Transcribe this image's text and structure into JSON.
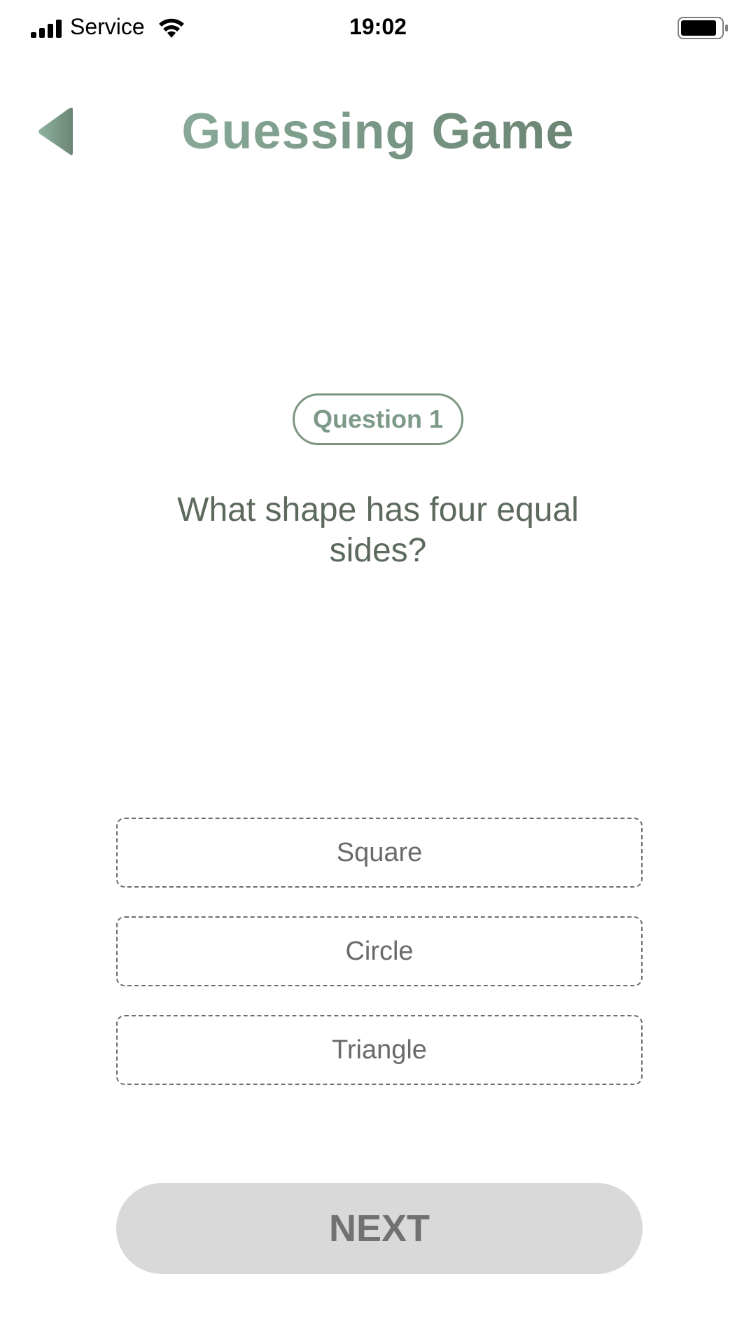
{
  "status_bar": {
    "carrier": "Service",
    "time": "19:02",
    "icons": [
      "signal-icon",
      "wifi-icon",
      "battery-icon"
    ]
  },
  "header": {
    "back_icon": "back-arrow-icon",
    "title": "Guessing Game"
  },
  "question": {
    "label": "Question 1",
    "text": "What shape has four equal sides?"
  },
  "options": [
    {
      "label": "Square"
    },
    {
      "label": "Circle"
    },
    {
      "label": "Triangle"
    }
  ],
  "next_button": {
    "label": "NEXT"
  },
  "colors": {
    "accent_light": "#97b8aa",
    "accent_dark": "#5f7362",
    "text": "#5c6a5e",
    "button_bg": "#d9d9d9",
    "button_text": "#717171"
  }
}
